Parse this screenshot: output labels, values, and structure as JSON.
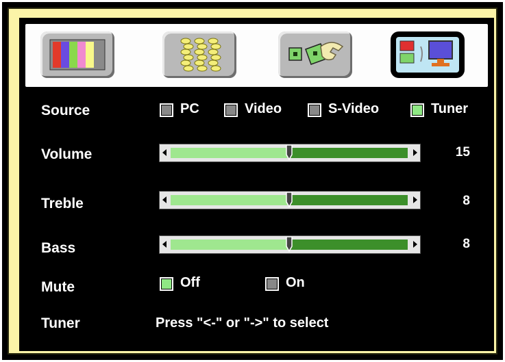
{
  "tabs": [
    {
      "name": "picture-tab",
      "icon": "color-bars-icon",
      "active": false
    },
    {
      "name": "audio-tab",
      "icon": "sound-waves-icon",
      "active": false
    },
    {
      "name": "setup-tab",
      "icon": "wrench-icon",
      "active": false
    },
    {
      "name": "input-tab",
      "icon": "source-monitor-icon",
      "active": true
    }
  ],
  "source": {
    "label": "Source",
    "options": [
      {
        "label": "PC",
        "selected": false
      },
      {
        "label": "Video",
        "selected": false
      },
      {
        "label": "S-Video",
        "selected": false
      },
      {
        "label": "Tuner",
        "selected": true
      }
    ]
  },
  "volume": {
    "label": "Volume",
    "value": "15",
    "fraction": 0.5
  },
  "treble": {
    "label": "Treble",
    "value": "8",
    "fraction": 0.5
  },
  "bass": {
    "label": "Bass",
    "value": "8",
    "fraction": 0.5
  },
  "mute": {
    "label": "Mute",
    "options": [
      {
        "label": "Off",
        "selected": true
      },
      {
        "label": "On",
        "selected": false
      }
    ]
  },
  "tuner": {
    "label": "Tuner",
    "hint": "Press \"<-\" or \"->\" to select"
  },
  "colors": {
    "selected_checkbox": "#8fe884",
    "slider_fill": "#9fe78f",
    "slider_track": "#3c8f2a",
    "bezel": "#fbf4a8"
  }
}
